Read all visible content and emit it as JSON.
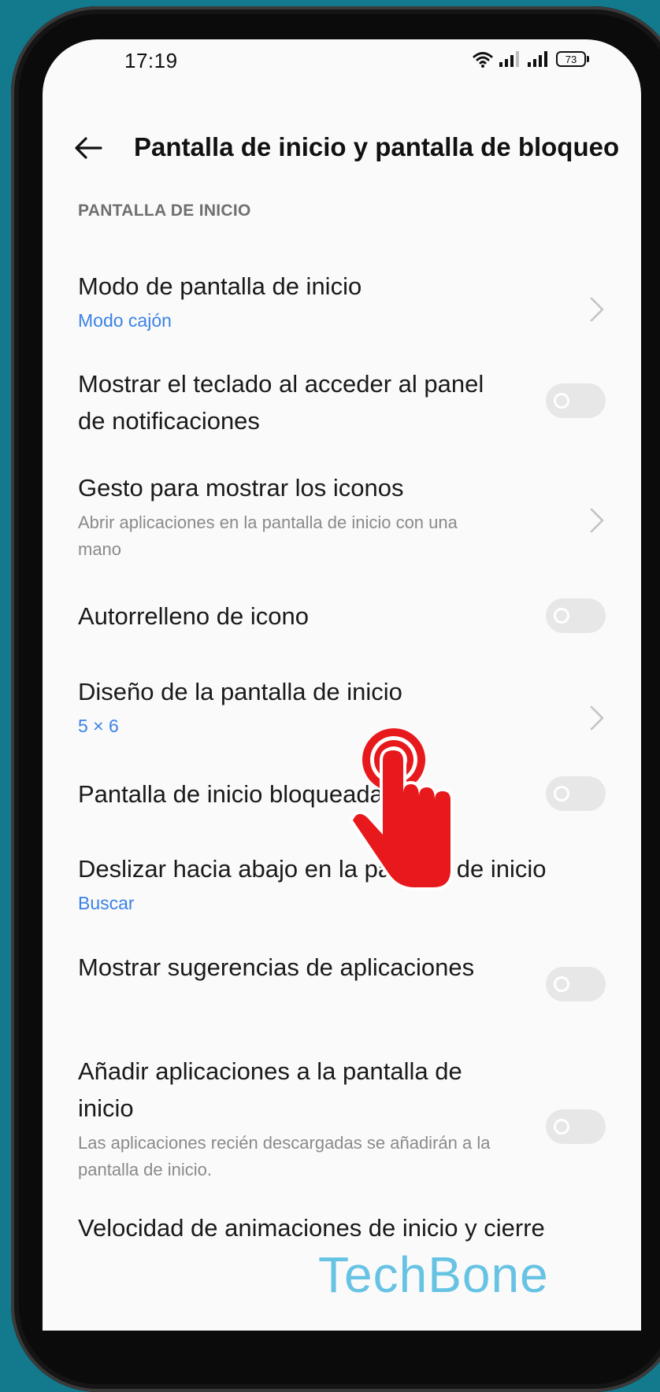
{
  "status_bar": {
    "time": "17:19",
    "battery": "73"
  },
  "header": {
    "title": "Pantalla de inicio y pantalla de bloqueo"
  },
  "section": {
    "title": "PANTALLA DE INICIO"
  },
  "items": [
    {
      "title": "Modo de pantalla de inicio",
      "value": "Modo cajón",
      "control": "chevron"
    },
    {
      "title": "Mostrar el teclado al acceder al panel de notificaciones",
      "control": "toggle",
      "enabled": false
    },
    {
      "title": "Gesto para mostrar los iconos",
      "description": "Abrir aplicaciones en la pantalla de inicio con una mano",
      "control": "chevron"
    },
    {
      "title": "Autorrelleno de icono",
      "control": "toggle",
      "enabled": false
    },
    {
      "title": "Diseño de la pantalla de inicio",
      "value": "5 × 6",
      "control": "chevron"
    },
    {
      "title": "Pantalla de inicio bloqueada",
      "control": "toggle",
      "enabled": false
    },
    {
      "title": "Deslizar hacia abajo en la pantalla de inicio",
      "value": "Buscar",
      "control": "none"
    },
    {
      "title": "Mostrar sugerencias de aplicaciones",
      "control": "toggle",
      "enabled": false
    },
    {
      "title": "Añadir aplicaciones a la pantalla de inicio",
      "description": "Las aplicaciones recién descargadas se añadirán a la pantalla de inicio.",
      "control": "toggle",
      "enabled": false
    },
    {
      "title": "Velocidad de animaciones de inicio y cierre"
    }
  ],
  "overlay": {
    "tap_icon": "tap-hand-icon",
    "tap_color": "#e8191c"
  },
  "watermark": "TechBone",
  "colors": {
    "background": "#127a8c",
    "accent_blue": "#3b82e6",
    "toggle_off": "#e7e7e7"
  }
}
